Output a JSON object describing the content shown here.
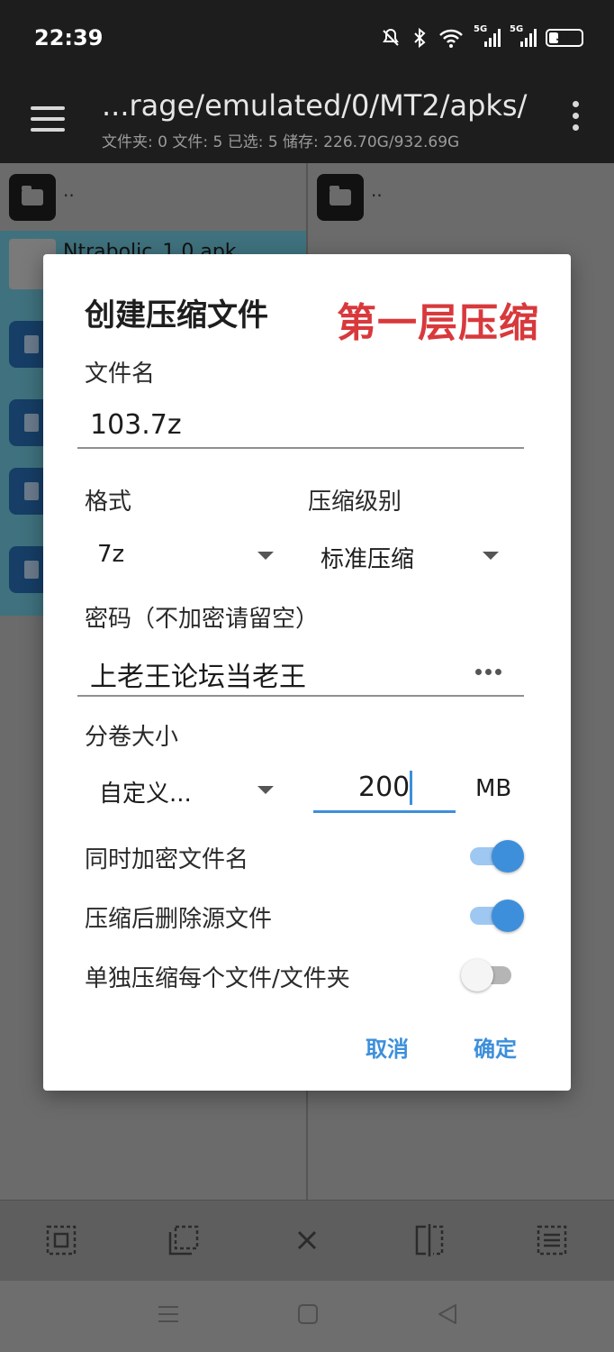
{
  "status_bar": {
    "time": "22:39",
    "battery_level": "31",
    "signal_1_label": "5G",
    "signal_2_label": "5G"
  },
  "toolbar": {
    "path": "...rage/emulated/0/MT2/apks/",
    "stats": "文件夹: 0  文件: 5  已选: 5  储存: 226.70G/932.69G"
  },
  "left_pane": {
    "parent_label": "..",
    "first_file_name": "Ntrabolic_1.0.apk"
  },
  "right_pane": {
    "parent_label": ".."
  },
  "dialog": {
    "title": "创建压缩文件",
    "overlay_text": "第一层压缩",
    "filename_label": "文件名",
    "filename_value": "103.7z",
    "format_label": "格式",
    "format_value": "7z",
    "level_label": "压缩级别",
    "level_value": "标准压缩",
    "password_label": "密码（不加密请留空）",
    "password_value": "上老王论坛当老王",
    "split_label": "分卷大小",
    "split_mode_value": "自定义...",
    "split_size_value": "200",
    "split_unit": "MB",
    "encrypt_names_label": "同时加密文件名",
    "encrypt_names_on": true,
    "delete_source_label": "压缩后删除源文件",
    "delete_source_on": true,
    "separate_label": "单独压缩每个文件/文件夹",
    "separate_on": false,
    "cancel_label": "取消",
    "ok_label": "确定"
  },
  "colors": {
    "accent": "#3d8fdb",
    "overlay_red": "#d8393c",
    "selected_row": "#3f727e"
  }
}
